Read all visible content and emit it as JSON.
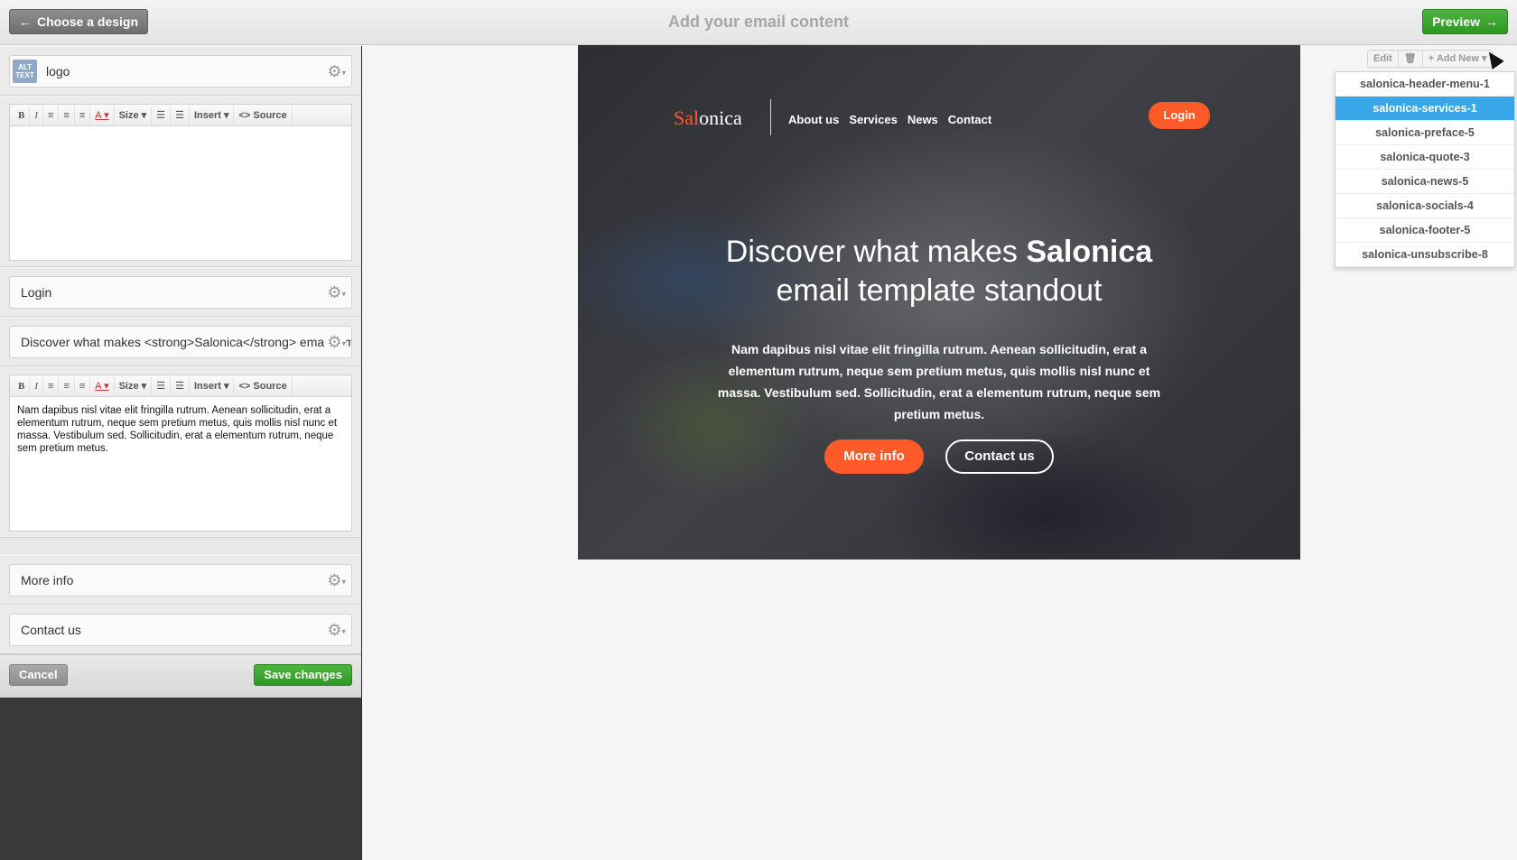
{
  "topbar": {
    "back_label": "Choose a design",
    "title": "Add your email content",
    "preview_label": "Preview"
  },
  "fields": {
    "logo": {
      "badge": "ALT TEXT",
      "value": "logo"
    },
    "login": {
      "value": "Login"
    },
    "headline": {
      "value": "Discover what makes <strong>Salonica</strong> email template standout"
    },
    "more_info": {
      "value": "More info"
    },
    "contact_us": {
      "value": "Contact us"
    }
  },
  "toolbar": {
    "bold": "B",
    "italic": "I",
    "color": "A",
    "size": "Size",
    "insert": "Insert",
    "source": "Source"
  },
  "editor2_text": "Nam dapibus nisl vitae elit fringilla rutrum. Aenean sollicitudin, erat a elementum rutrum, neque sem pretium metus, quis mollis nisl nunc et massa. Vestibulum sed. Sollicitudin, erat a elementum rutrum, neque sem pretium metus.",
  "footer": {
    "cancel": "Cancel",
    "save": "Save changes"
  },
  "email": {
    "brand_accent": "Sal",
    "brand_rest": "onica",
    "nav": [
      "About us",
      "Services",
      "News",
      "Contact"
    ],
    "login": "Login",
    "headline_pre": "Discover what makes ",
    "headline_strong": "Salonica",
    "headline_line2": "email template standout",
    "body": "Nam dapibus nisl vitae elit fringilla rutrum. Aenean sollicitudin, erat a elementum rutrum, neque sem pretium metus, quis mollis nisl nunc et massa. Vestibulum sed. Sollicitudin, erat a elementum rutrum, neque sem pretium metus.",
    "btn_more": "More info",
    "btn_contact": "Contact us",
    "accent_color": "#ff5a2a"
  },
  "block_tools": {
    "edit": "Edit",
    "add_new": "Add New"
  },
  "blocks": [
    {
      "label": "salonica-header-menu-1",
      "active": false
    },
    {
      "label": "salonica-services-1",
      "active": true
    },
    {
      "label": "salonica-preface-5",
      "active": false
    },
    {
      "label": "salonica-quote-3",
      "active": false
    },
    {
      "label": "salonica-news-5",
      "active": false
    },
    {
      "label": "salonica-socials-4",
      "active": false
    },
    {
      "label": "salonica-footer-5",
      "active": false
    },
    {
      "label": "salonica-unsubscribe-8",
      "active": false
    }
  ]
}
